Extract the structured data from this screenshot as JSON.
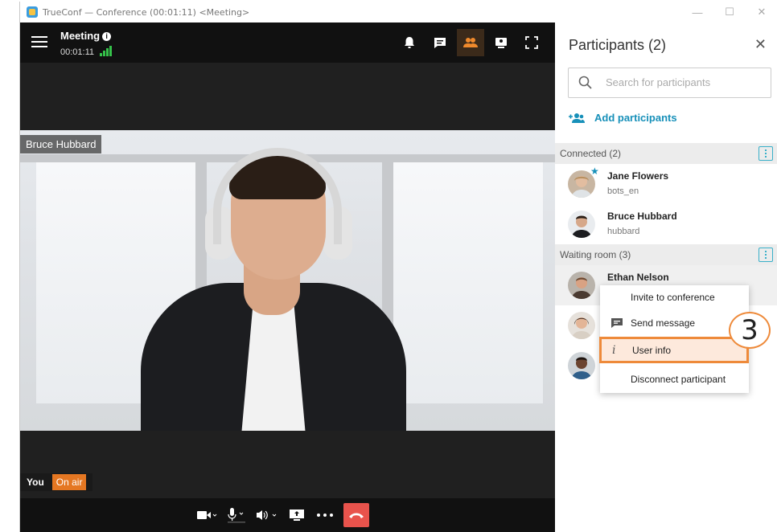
{
  "window": {
    "title": "TrueConf — Conference (00:01:11) <Meeting>",
    "controls": [
      "—",
      "☐",
      "✕"
    ]
  },
  "header": {
    "title": "Meeting",
    "info_icon": "i",
    "elapsed": "00:01:11",
    "tools": [
      "bell-icon",
      "chat-icon",
      "participants-icon",
      "layout-icon",
      "fullscreen-icon"
    ],
    "active_tool": "participants-icon"
  },
  "video": {
    "speaker_name": "Bruce Hubbard",
    "self_label": "You",
    "status_badge": "On air"
  },
  "controls": [
    "camera-icon",
    "microphone-icon",
    "speaker-icon",
    "share-screen-icon",
    "more-icon",
    "hangup-icon"
  ],
  "participants_panel": {
    "title": "Participants (2)",
    "close": "✕",
    "search_placeholder": "Search for participants",
    "add_label": "Add participants",
    "connected_label": "Connected (2)",
    "connected": [
      {
        "name": "Jane Flowers",
        "login": "bots_en",
        "owner": true
      },
      {
        "name": "Bruce Hubbard",
        "login": "hubbard",
        "owner": false
      }
    ],
    "waiting_label": "Waiting room (3)",
    "waiting": [
      {
        "name": "Ethan Nelson"
      }
    ]
  },
  "context_menu": {
    "items": [
      {
        "label": "Invite to conference"
      },
      {
        "label": "Send message"
      },
      {
        "label": "User info"
      },
      {
        "label": "Disconnect participant"
      }
    ],
    "selected": "User info"
  },
  "callout": "3",
  "colors": {
    "accent": "#1790b9",
    "on_air": "#e57722",
    "highlight": "#ee8a3a",
    "hangup": "#e8534c",
    "signal": "#35c24a"
  }
}
